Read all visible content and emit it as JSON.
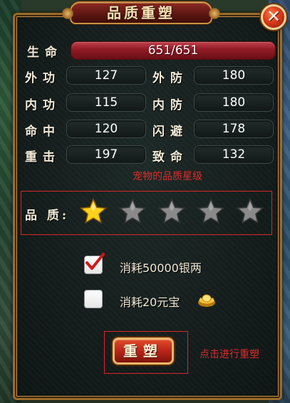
{
  "dialog": {
    "title": "品质重塑",
    "close_symbol": "✕"
  },
  "stats": {
    "hp": {
      "label": "生命",
      "value": "651/651"
    },
    "rows": [
      {
        "left_label": "外功",
        "left_value": "127",
        "right_label": "外防",
        "right_value": "180"
      },
      {
        "left_label": "内功",
        "left_value": "115",
        "right_label": "内防",
        "right_value": "180"
      },
      {
        "left_label": "命中",
        "left_value": "120",
        "right_label": "闪避",
        "right_value": "178"
      },
      {
        "left_label": "重击",
        "left_value": "197",
        "right_label": "致命",
        "right_value": "132"
      }
    ]
  },
  "quality": {
    "annotation": "宠物的品质星级",
    "label": "品 质:",
    "stars_total": 5,
    "stars_filled": 1
  },
  "costs": [
    {
      "label": "消耗50000银两",
      "checked": true
    },
    {
      "label": "消耗20元宝",
      "checked": false,
      "icon": "gold-ingot-icon"
    }
  ],
  "action": {
    "button_label": "重塑",
    "annotation": "点击进行重塑"
  },
  "colors": {
    "annotation_red": "#e02a2a",
    "star_gold": "#ffd21a",
    "star_grey": "#8a8a8a",
    "hp_bar": "#8f1a24"
  }
}
